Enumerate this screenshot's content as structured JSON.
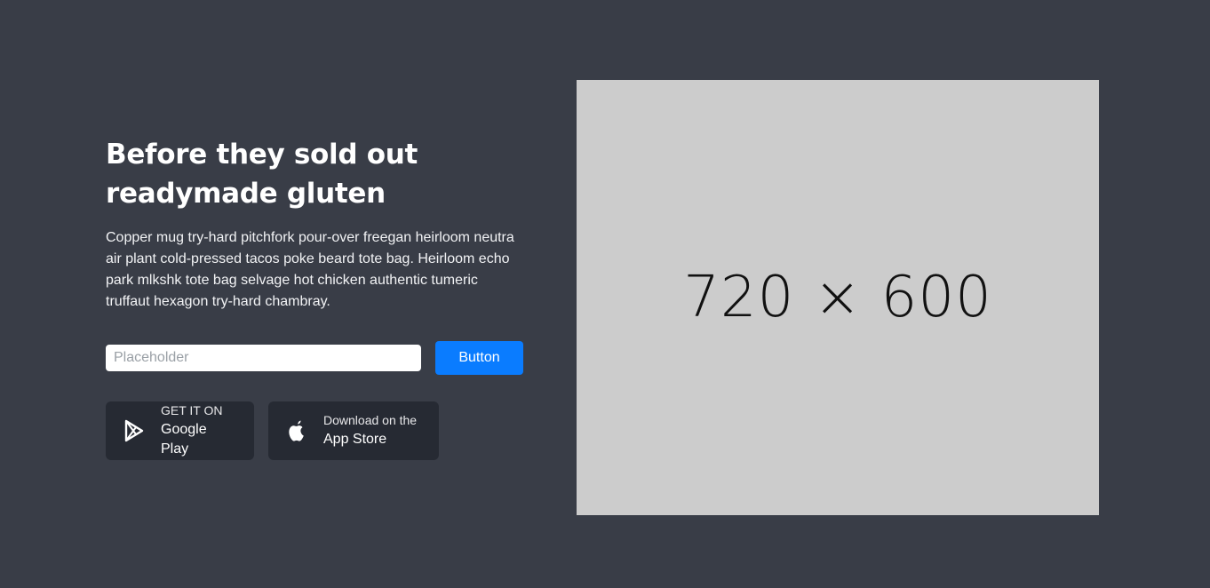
{
  "hero": {
    "heading": "Before they sold out readymade gluten",
    "description": "Copper mug try-hard pitchfork pour-over freegan heirloom neutra air plant cold-pressed tacos poke beard tote bag. Heirloom echo park mlkshk tote bag selvage hot chicken authentic tumeric truffaut hexagon try-hard chambray."
  },
  "form": {
    "input_placeholder": "Placeholder",
    "button_label": "Button"
  },
  "stores": {
    "google_play": {
      "small": "GET IT ON",
      "large": "Google Play",
      "icon": "google-play-icon"
    },
    "app_store": {
      "small": "Download on the",
      "large": "App Store",
      "icon": "apple-icon"
    }
  },
  "image": {
    "label": "720 × 600"
  },
  "colors": {
    "background": "#393d47",
    "accent": "#0a7cff",
    "store_button_bg": "#262a33",
    "image_bg": "#cccccc"
  }
}
